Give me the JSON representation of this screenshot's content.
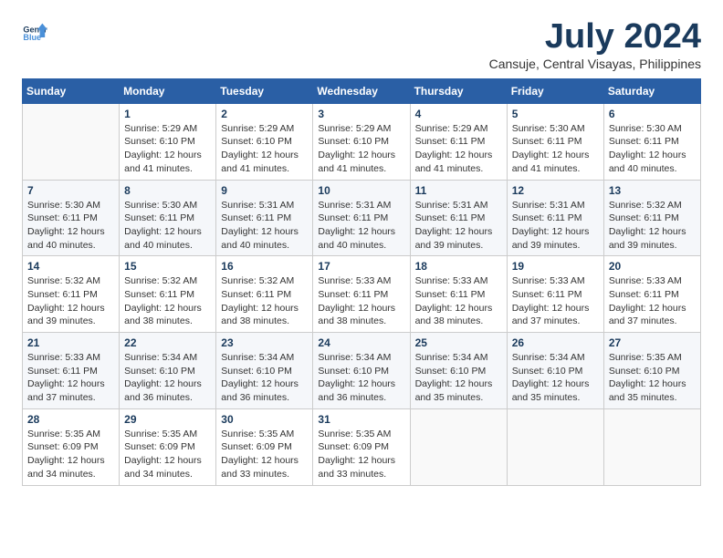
{
  "logo": {
    "line1": "General",
    "line2": "Blue"
  },
  "title": "July 2024",
  "subtitle": "Cansuje, Central Visayas, Philippines",
  "header_days": [
    "Sunday",
    "Monday",
    "Tuesday",
    "Wednesday",
    "Thursday",
    "Friday",
    "Saturday"
  ],
  "weeks": [
    [
      {
        "day": "",
        "info": ""
      },
      {
        "day": "1",
        "info": "Sunrise: 5:29 AM\nSunset: 6:10 PM\nDaylight: 12 hours\nand 41 minutes."
      },
      {
        "day": "2",
        "info": "Sunrise: 5:29 AM\nSunset: 6:10 PM\nDaylight: 12 hours\nand 41 minutes."
      },
      {
        "day": "3",
        "info": "Sunrise: 5:29 AM\nSunset: 6:10 PM\nDaylight: 12 hours\nand 41 minutes."
      },
      {
        "day": "4",
        "info": "Sunrise: 5:29 AM\nSunset: 6:11 PM\nDaylight: 12 hours\nand 41 minutes."
      },
      {
        "day": "5",
        "info": "Sunrise: 5:30 AM\nSunset: 6:11 PM\nDaylight: 12 hours\nand 41 minutes."
      },
      {
        "day": "6",
        "info": "Sunrise: 5:30 AM\nSunset: 6:11 PM\nDaylight: 12 hours\nand 40 minutes."
      }
    ],
    [
      {
        "day": "7",
        "info": "Sunrise: 5:30 AM\nSunset: 6:11 PM\nDaylight: 12 hours\nand 40 minutes."
      },
      {
        "day": "8",
        "info": "Sunrise: 5:30 AM\nSunset: 6:11 PM\nDaylight: 12 hours\nand 40 minutes."
      },
      {
        "day": "9",
        "info": "Sunrise: 5:31 AM\nSunset: 6:11 PM\nDaylight: 12 hours\nand 40 minutes."
      },
      {
        "day": "10",
        "info": "Sunrise: 5:31 AM\nSunset: 6:11 PM\nDaylight: 12 hours\nand 40 minutes."
      },
      {
        "day": "11",
        "info": "Sunrise: 5:31 AM\nSunset: 6:11 PM\nDaylight: 12 hours\nand 39 minutes."
      },
      {
        "day": "12",
        "info": "Sunrise: 5:31 AM\nSunset: 6:11 PM\nDaylight: 12 hours\nand 39 minutes."
      },
      {
        "day": "13",
        "info": "Sunrise: 5:32 AM\nSunset: 6:11 PM\nDaylight: 12 hours\nand 39 minutes."
      }
    ],
    [
      {
        "day": "14",
        "info": "Sunrise: 5:32 AM\nSunset: 6:11 PM\nDaylight: 12 hours\nand 39 minutes."
      },
      {
        "day": "15",
        "info": "Sunrise: 5:32 AM\nSunset: 6:11 PM\nDaylight: 12 hours\nand 38 minutes."
      },
      {
        "day": "16",
        "info": "Sunrise: 5:32 AM\nSunset: 6:11 PM\nDaylight: 12 hours\nand 38 minutes."
      },
      {
        "day": "17",
        "info": "Sunrise: 5:33 AM\nSunset: 6:11 PM\nDaylight: 12 hours\nand 38 minutes."
      },
      {
        "day": "18",
        "info": "Sunrise: 5:33 AM\nSunset: 6:11 PM\nDaylight: 12 hours\nand 38 minutes."
      },
      {
        "day": "19",
        "info": "Sunrise: 5:33 AM\nSunset: 6:11 PM\nDaylight: 12 hours\nand 37 minutes."
      },
      {
        "day": "20",
        "info": "Sunrise: 5:33 AM\nSunset: 6:11 PM\nDaylight: 12 hours\nand 37 minutes."
      }
    ],
    [
      {
        "day": "21",
        "info": "Sunrise: 5:33 AM\nSunset: 6:11 PM\nDaylight: 12 hours\nand 37 minutes."
      },
      {
        "day": "22",
        "info": "Sunrise: 5:34 AM\nSunset: 6:10 PM\nDaylight: 12 hours\nand 36 minutes."
      },
      {
        "day": "23",
        "info": "Sunrise: 5:34 AM\nSunset: 6:10 PM\nDaylight: 12 hours\nand 36 minutes."
      },
      {
        "day": "24",
        "info": "Sunrise: 5:34 AM\nSunset: 6:10 PM\nDaylight: 12 hours\nand 36 minutes."
      },
      {
        "day": "25",
        "info": "Sunrise: 5:34 AM\nSunset: 6:10 PM\nDaylight: 12 hours\nand 35 minutes."
      },
      {
        "day": "26",
        "info": "Sunrise: 5:34 AM\nSunset: 6:10 PM\nDaylight: 12 hours\nand 35 minutes."
      },
      {
        "day": "27",
        "info": "Sunrise: 5:35 AM\nSunset: 6:10 PM\nDaylight: 12 hours\nand 35 minutes."
      }
    ],
    [
      {
        "day": "28",
        "info": "Sunrise: 5:35 AM\nSunset: 6:09 PM\nDaylight: 12 hours\nand 34 minutes."
      },
      {
        "day": "29",
        "info": "Sunrise: 5:35 AM\nSunset: 6:09 PM\nDaylight: 12 hours\nand 34 minutes."
      },
      {
        "day": "30",
        "info": "Sunrise: 5:35 AM\nSunset: 6:09 PM\nDaylight: 12 hours\nand 33 minutes."
      },
      {
        "day": "31",
        "info": "Sunrise: 5:35 AM\nSunset: 6:09 PM\nDaylight: 12 hours\nand 33 minutes."
      },
      {
        "day": "",
        "info": ""
      },
      {
        "day": "",
        "info": ""
      },
      {
        "day": "",
        "info": ""
      }
    ]
  ]
}
